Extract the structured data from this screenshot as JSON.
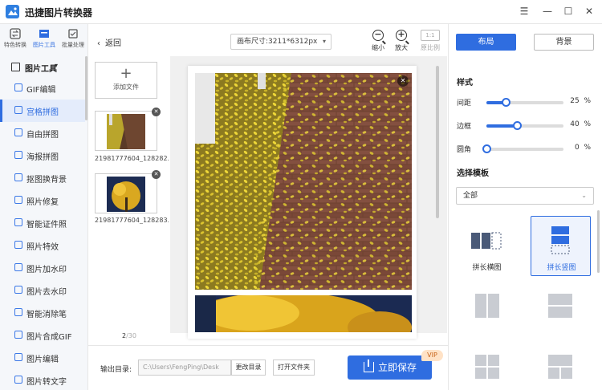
{
  "app": {
    "title": "迅捷图片转换器"
  },
  "window": {
    "menu_icon": "menu-icon",
    "minimize_icon": "minimize-icon",
    "maximize_icon": "maximize-icon",
    "close_icon": "close-icon"
  },
  "topnav": {
    "items": [
      {
        "label": "特色转换",
        "icon": "convert-icon"
      },
      {
        "label": "图片工具",
        "icon": "image-tools-icon",
        "active": true
      },
      {
        "label": "批量处理",
        "icon": "batch-icon"
      }
    ]
  },
  "sidebar": {
    "section_title": "图片工具",
    "items": [
      {
        "label": "GIF编辑"
      },
      {
        "label": "宫格拼图",
        "active": true
      },
      {
        "label": "自由拼图"
      },
      {
        "label": "海报拼图"
      },
      {
        "label": "抠图换背景"
      },
      {
        "label": "照片修复"
      },
      {
        "label": "智能证件照"
      },
      {
        "label": "照片特效"
      },
      {
        "label": "图片加水印"
      },
      {
        "label": "图片去水印"
      },
      {
        "label": "智能消除笔"
      },
      {
        "label": "图片合成GIF"
      },
      {
        "label": "图片编辑"
      },
      {
        "label": "图片转文字"
      }
    ]
  },
  "editor": {
    "back_label": "返回",
    "canvas_size": "画布尺寸:3211*6312px",
    "zoom_out_label": "缩小",
    "zoom_in_label": "放大",
    "ratio_box": "1:1",
    "ratio_label": "原比例"
  },
  "files": {
    "add_label": "添加文件",
    "items": [
      {
        "name": "21981777604_128282..."
      },
      {
        "name": "21981777604_128283..."
      }
    ],
    "page_current": "2",
    "page_total": "/30"
  },
  "output": {
    "label": "输出目录:",
    "path": "C:\\Users\\FengPing\\Desk",
    "change_label": "更改目录",
    "open_folder_label": "打开文件夹",
    "save_label": "立即保存",
    "vip_badge": "VIP"
  },
  "panel": {
    "tab_layout": "布局",
    "tab_background": "背景",
    "style_title": "样式",
    "sliders": [
      {
        "label": "间距",
        "value": 25,
        "unit": "%"
      },
      {
        "label": "边框",
        "value": 40,
        "unit": "%"
      },
      {
        "label": "圆角",
        "value": 0,
        "unit": "%"
      }
    ],
    "template_title": "选择模板",
    "template_filter": "全部",
    "templates": [
      {
        "label": "拼长横图",
        "selected": false
      },
      {
        "label": "拼长竖图",
        "selected": true
      }
    ]
  },
  "colors": {
    "accent": "#2f6de0",
    "vip_bg": "#ffe2c6",
    "vip_text": "#c8651d"
  }
}
